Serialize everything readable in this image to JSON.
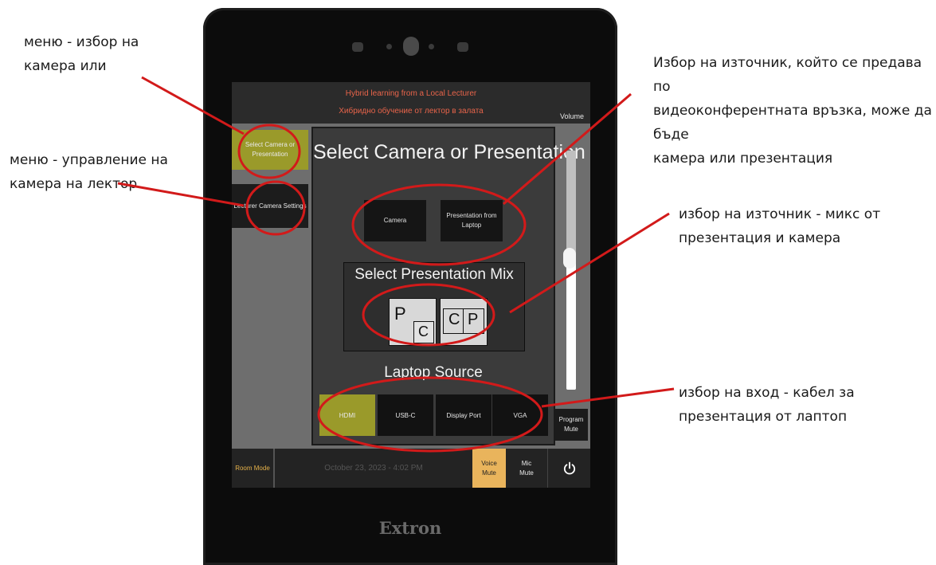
{
  "annotations": {
    "menu_camera": "меню - избор на\nкамера или",
    "menu_lecturer": "меню - управление на\nкамера на лектор",
    "source_select": "Избор на източник, който се предава по\nвидеоконферентната връзка, може да бъде\nкамера или презентация",
    "mix_select": "избор на източник - микс от\nпрезентация и камера",
    "input_select": "избор на вход - кабел за\nпрезентация от лаптоп"
  },
  "header": {
    "line1": "Hybrid learning from a Local Lecturer",
    "line2": "Хибридно обучение от лектор в залата"
  },
  "sidebar": {
    "items": [
      {
        "label": "Select Camera or\nPresentation",
        "active": true
      },
      {
        "label": "Lecturer Camera Settings",
        "active": false
      }
    ]
  },
  "main": {
    "title": "Select Camera or Presentation",
    "sources": [
      "Camera",
      "Presentation from\nLaptop"
    ],
    "mix_title": "Select Presentation Mix",
    "mix_options": [
      {
        "main": "P",
        "inset": "C"
      },
      {
        "left": "C",
        "right": "P"
      }
    ],
    "laptop_title": "Laptop Source",
    "laptop_inputs": [
      "HDMI",
      "USB-C",
      "Display Port",
      "VGA"
    ],
    "laptop_selected": "HDMI"
  },
  "volume": {
    "label": "Volume",
    "level": 0.55,
    "program_mute": "Program\nMute"
  },
  "footer": {
    "room_mode": "Room Mode",
    "datetime": "October 23, 2023 - 4:02 PM",
    "voice_mute": "Voice\nMute",
    "mic_mute": "Mic\nMute",
    "power_icon": "power-icon"
  },
  "device": {
    "brand": "Extron"
  },
  "colors": {
    "accent_olive": "#9a9a2a",
    "voice_mute": "#e9b45c",
    "header_text": "#e8644a",
    "annotation": "#d21a1a"
  }
}
